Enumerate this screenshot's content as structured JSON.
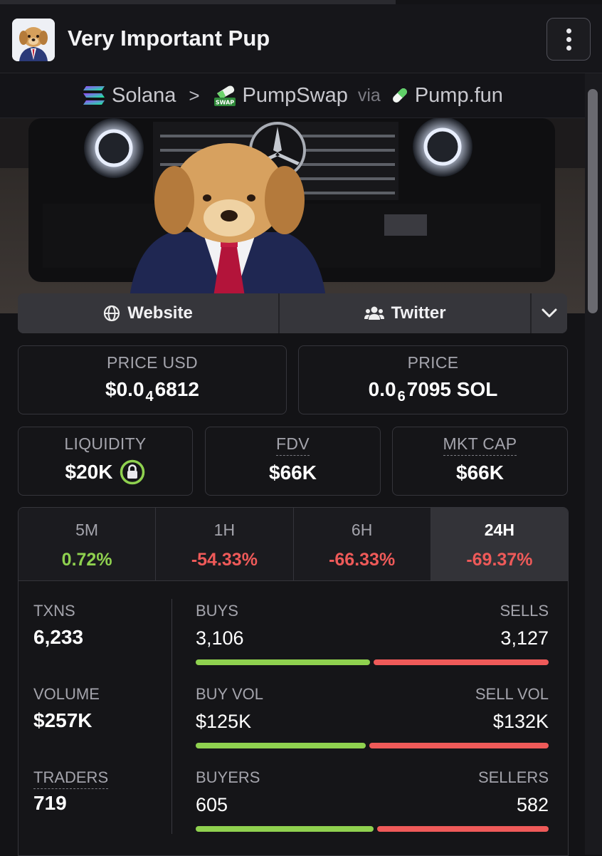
{
  "header": {
    "title": "Very Important Pup",
    "menu_icon": "kebab-menu-icon"
  },
  "breadcrumb": {
    "chain": "Solana",
    "separator": ">",
    "dex": "PumpSwap",
    "dex_badge": "SWAP",
    "via": "via",
    "launchpad": "Pump.fun"
  },
  "links": {
    "website": "Website",
    "twitter": "Twitter"
  },
  "price_usd": {
    "label": "PRICE USD",
    "prefix": "$0.0",
    "zeros": "4",
    "digits": "6812"
  },
  "price_native": {
    "label": "PRICE",
    "prefix": "0.0",
    "zeros": "6",
    "digits": "7095 SOL"
  },
  "liquidity": {
    "label": "LIQUIDITY",
    "value": "$20K"
  },
  "fdv": {
    "label": "FDV",
    "value": "$66K"
  },
  "mkt_cap": {
    "label": "MKT CAP",
    "value": "$66K"
  },
  "timeframes": [
    {
      "label": "5M",
      "change": "0.72%"
    },
    {
      "label": "1H",
      "change": "-54.33%"
    },
    {
      "label": "6H",
      "change": "-66.33%"
    },
    {
      "label": "24H",
      "change": "-69.37%"
    }
  ],
  "active_timeframe": "24H",
  "stats": {
    "txns": {
      "label": "TXNS",
      "value": "6,233"
    },
    "volume": {
      "label": "VOLUME",
      "value": "$257K"
    },
    "traders": {
      "label": "TRADERS",
      "value": "719"
    },
    "buys": {
      "label": "BUYS",
      "value": "3,106"
    },
    "sells": {
      "label": "SELLS",
      "value": "3,127"
    },
    "buy_vol": {
      "label": "BUY VOL",
      "value": "$125K"
    },
    "sell_vol": {
      "label": "SELL VOL",
      "value": "$132K"
    },
    "buyers": {
      "label": "BUYERS",
      "value": "605"
    },
    "sellers": {
      "label": "SELLERS",
      "value": "582"
    }
  },
  "ratios": {
    "buys_share": 0.498,
    "buy_vol_share": 0.486,
    "buyers_share": 0.51
  },
  "colors": {
    "positive": "#8fd14f",
    "negative": "#ef5a59",
    "background": "#131316"
  }
}
